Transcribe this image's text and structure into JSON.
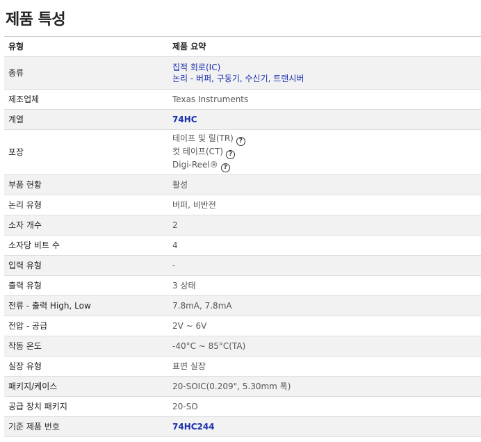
{
  "page_title": "제품 특성",
  "header": {
    "type": "유형",
    "summary": "제품 요약"
  },
  "rows": {
    "category": {
      "label": "종류",
      "link1": "집적 회로(IC)",
      "link2": "논리 - 버퍼, 구동기, 수신기, 트랜시버"
    },
    "manufacturer": {
      "label": "제조업체",
      "value": "Texas Instruments"
    },
    "series": {
      "label": "계열",
      "value": "74HC"
    },
    "packaging": {
      "label": "포장",
      "opt1": "테이프 및 릴(TR)",
      "opt2": "컷 테이프(CT)",
      "opt3": "Digi-Reel®"
    },
    "part_status": {
      "label": "부품 현황",
      "value": "활성"
    },
    "logic_type": {
      "label": "논리 유형",
      "value": "버퍼, 비반전"
    },
    "num_elements": {
      "label": "소자 개수",
      "value": "2"
    },
    "bits_per_element": {
      "label": "소자당 비트 수",
      "value": "4"
    },
    "input_type": {
      "label": "입력 유형",
      "value": "-"
    },
    "output_type": {
      "label": "출력 유형",
      "value": "3 상태"
    },
    "current_output": {
      "label": "전류 - 출력 High, Low",
      "value": "7.8mA, 7.8mA"
    },
    "voltage_supply": {
      "label": "전압 - 공급",
      "value": "2V ~ 6V"
    },
    "operating_temp": {
      "label": "작동 온도",
      "value": "-40°C ~ 85°C(TA)"
    },
    "mounting_type": {
      "label": "실장 유형",
      "value": "표면 실장"
    },
    "package_case": {
      "label": "패키지/케이스",
      "value": "20-SOIC(0.209\", 5.30mm 폭)"
    },
    "supplier_package": {
      "label": "공급 장치 패키지",
      "value": "20-SO"
    },
    "base_part": {
      "label": "기준 제품 번호",
      "value": "74HC244"
    }
  },
  "colors": {
    "link": "#1a2fb0",
    "shade": "#f2f2f2",
    "border": "#dedede"
  },
  "icons": {
    "help": "question-circle-icon"
  }
}
